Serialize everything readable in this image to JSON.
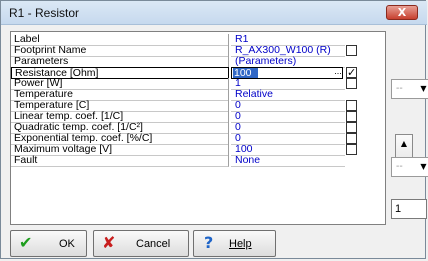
{
  "window": {
    "title": "R1 - Resistor",
    "close_label": "X"
  },
  "properties": [
    {
      "name": "Label",
      "value": "R1",
      "checkbox": false,
      "checked": false
    },
    {
      "name": "Footprint Name",
      "value": "R_AX300_W100 (R)",
      "checkbox": true,
      "checked": false
    },
    {
      "name": "Parameters",
      "value": "(Parameters)",
      "checkbox": false,
      "checked": false
    },
    {
      "name": "Resistance [Ohm]",
      "value": "100",
      "checkbox": true,
      "checked": true,
      "selected": true,
      "button": "..."
    },
    {
      "name": "Power      [W]",
      "value": "1",
      "checkbox": true,
      "checked": false
    },
    {
      "name": "Temperature",
      "value": "Relative",
      "checkbox": false,
      "checked": false
    },
    {
      "name": "Temperature [C]",
      "value": "0",
      "checkbox": true,
      "checked": false
    },
    {
      "name": "Linear temp. coef. [1/C]",
      "value": "0",
      "checkbox": true,
      "checked": false
    },
    {
      "name": "Quadratic temp. coef. [1/C²]",
      "value": "0",
      "checkbox": true,
      "checked": false
    },
    {
      "name": "Exponential temp. coef. [%/C]",
      "value": "0",
      "checkbox": true,
      "checked": false
    },
    {
      "name": "Maximum voltage [V]",
      "value": "100",
      "checkbox": true,
      "checked": false
    },
    {
      "name": "Fault",
      "value": "None",
      "checkbox": false,
      "checked": false
    }
  ],
  "buttons": {
    "ok": "OK",
    "cancel": "Cancel",
    "help": "Help"
  },
  "icons": {
    "ok": "checkmark-icon",
    "cancel": "red-x-icon",
    "help": "question-icon",
    "check": "✓"
  },
  "side_panel": {
    "combo1": "--",
    "combo2": "--",
    "number": "1"
  },
  "colors": {
    "value_text": "#0000c8",
    "selection": "#3168c6",
    "ok_icon": "#1e9e1e",
    "cancel_icon": "#c81e1e",
    "help_icon": "#1e64c8"
  }
}
